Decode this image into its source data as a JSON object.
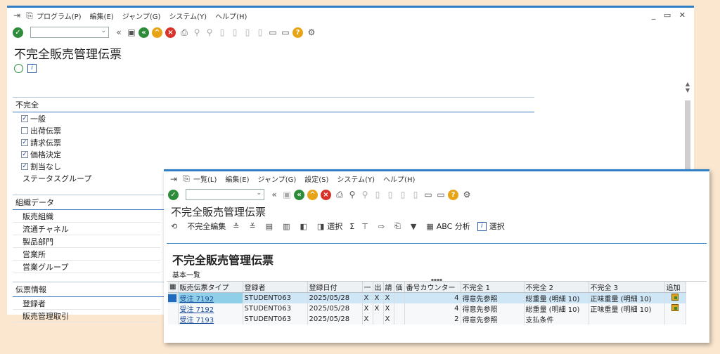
{
  "back_window": {
    "menu": [
      "プログラム(P)",
      "編集(E)",
      "ジャンプ(G)",
      "システム(Y)",
      "ヘルプ(H)"
    ],
    "window_controls": "_ ▭ ✕",
    "title": "不完全販売管理伝票",
    "section_incomplete": {
      "title": "不完全",
      "checks": [
        {
          "label": "一般",
          "checked": true
        },
        {
          "label": "出荷伝票",
          "checked": false
        },
        {
          "label": "請求伝票",
          "checked": true
        },
        {
          "label": "価格決定",
          "checked": true
        },
        {
          "label": "割当なし",
          "checked": true
        }
      ],
      "status_group_label": "ステータスグループ"
    },
    "section_org": {
      "title": "組織データ",
      "fields": [
        "販売組織",
        "流通チャネル",
        "製品部門",
        "営業所",
        "営業グループ"
      ]
    },
    "section_doc": {
      "title": "伝票情報",
      "fields": [
        "登録者",
        "販売管理取引"
      ]
    }
  },
  "front_window": {
    "menu": [
      "一覧(L)",
      "編集(E)",
      "ジャンプ(G)",
      "設定(S)",
      "システム(Y)",
      "ヘルプ(H)"
    ],
    "title": "不完全販売管理伝票",
    "appbar": {
      "edit_incomplete": "不完全編集",
      "select1": "選択",
      "sum": "Σ",
      "abc": "ABC 分析",
      "select2": "選択"
    },
    "content_title": "不完全販売管理伝票",
    "content_subtitle": "基本一覧",
    "table": {
      "headers": [
        "販売伝票タイプ",
        "登録者",
        "登録日付",
        "一",
        "出",
        "請",
        "価",
        "番号カウンター",
        "不完全 1",
        "不完全 2",
        "不完全 3",
        "追加"
      ],
      "rows": [
        [
          "受注 7192",
          "STUDENT063",
          "2025/05/28",
          "X",
          "X",
          "X",
          "",
          "4",
          "得意先参照",
          "総重量 (明細 10)",
          "正味重量 (明細 10)"
        ],
        [
          "受注 7192",
          "STUDENT063",
          "2025/05/28",
          "X",
          "X",
          "X",
          "",
          "4",
          "得意先参照",
          "総重量 (明細 10)",
          "正味重量 (明細 10)"
        ],
        [
          "受注 7193",
          "STUDENT063",
          "2025/05/28",
          "X",
          "",
          "X",
          "",
          "2",
          "得意先参照",
          "支払条件",
          ""
        ]
      ]
    }
  },
  "colors": {
    "background": "#fbe7cf",
    "accent_blue": "#2f7ec8",
    "ok_green": "#2e8b3a",
    "cancel_red": "#d8322b",
    "exit_orange": "#e7a417",
    "row_highlight": "#cfe6f7"
  }
}
